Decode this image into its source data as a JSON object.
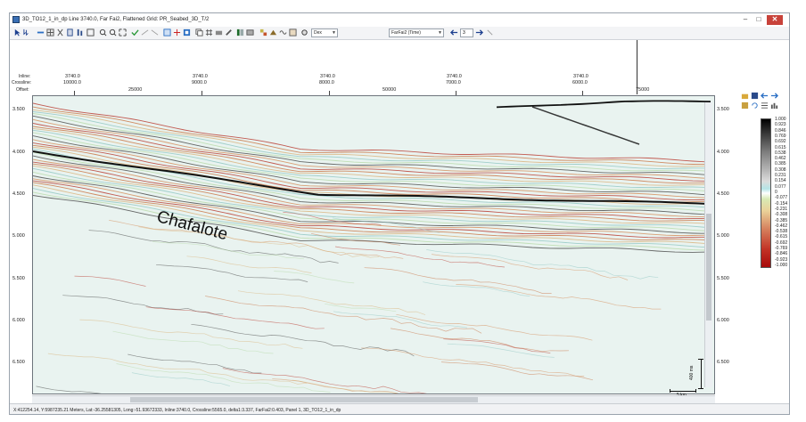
{
  "window": {
    "title": "3D_TO12_1_in_dp Line 3740.0, Far Fai2, Flattened Grid: PR_Seabed_3D_T/2",
    "min_label": "–",
    "max_label": "□",
    "close_label": "✕"
  },
  "toolbar": {
    "display_combo": "Dex",
    "dataset_combo": "FarFai2 (Time)",
    "step_value": "3"
  },
  "header": {
    "row_labels": [
      "Inline:",
      "Crossline:",
      "Offset:"
    ],
    "ticks": [
      {
        "inline": "3740.0",
        "crossline": "10000.0",
        "offset": "25000"
      },
      {
        "inline": "3740.0",
        "crossline": "9000.0",
        "offset": "50000"
      },
      {
        "inline": "3740.0",
        "crossline": "8000.0",
        "offset": "75000"
      },
      {
        "inline": "3740.0",
        "crossline": "7000.0",
        "offset": ""
      },
      {
        "inline": "3740.0",
        "crossline": "6000.0",
        "offset": ""
      }
    ]
  },
  "time_axis": [
    "3.500",
    "4.000",
    "4.500",
    "5.000",
    "5.500",
    "6.000",
    "6.500"
  ],
  "annotation": "Chafalote",
  "scalebars": {
    "vertical": "400 ms",
    "horizontal": "5 km"
  },
  "colorbar": {
    "labels": [
      "1.000",
      "0.923",
      "0.846",
      "0.769",
      "0.692",
      "0.615",
      "0.538",
      "0.462",
      "0.385",
      "0.308",
      "0.231",
      "0.154",
      "0.077",
      "0",
      "-0.077",
      "-0.154",
      "-0.231",
      "-0.308",
      "-0.385",
      "-0.462",
      "-0.538",
      "-0.615",
      "-0.692",
      "-0.769",
      "-0.846",
      "-0.923",
      "-1.000"
    ]
  },
  "status": "X:412254.14, Y:5987235.21 Meters, Lat:-36.25581305, Long:-51.93672333, Inline:3740.0, Crossline:5565.0, delta1:3.337, FarFai2:0.403, Panel 1, 3D_TO12_1_in_dp",
  "colors": {
    "accent": "#c8423a",
    "panel": "#f3f4f6"
  }
}
